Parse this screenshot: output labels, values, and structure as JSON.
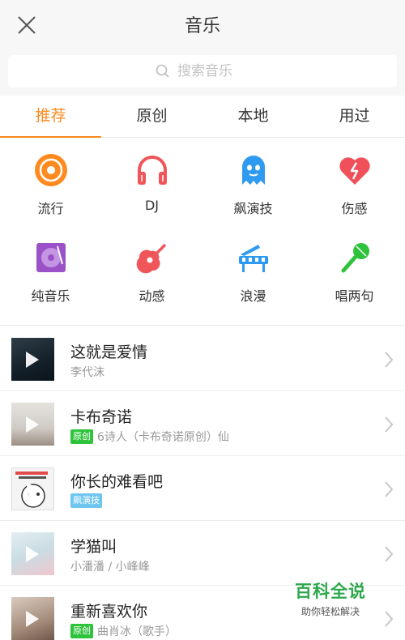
{
  "header": {
    "title": "音乐"
  },
  "search": {
    "placeholder": "搜索音乐"
  },
  "tabs": [
    {
      "label": "推荐",
      "active": true
    },
    {
      "label": "原创",
      "active": false
    },
    {
      "label": "本地",
      "active": false
    },
    {
      "label": "用过",
      "active": false
    }
  ],
  "genres": [
    {
      "label": "流行",
      "icon": "vinyl-record-icon",
      "color": "#ff8a1f"
    },
    {
      "label": "DJ",
      "icon": "headphones-icon",
      "color": "#f0555a"
    },
    {
      "label": "飙演技",
      "icon": "ghost-icon",
      "color": "#2f9bf0"
    },
    {
      "label": "伤感",
      "icon": "broken-heart-icon",
      "color": "#f0505a"
    },
    {
      "label": "纯音乐",
      "icon": "album-disc-icon",
      "color": "#9b52c8"
    },
    {
      "label": "动感",
      "icon": "guitar-icon",
      "color": "#f0555a"
    },
    {
      "label": "浪漫",
      "icon": "piano-icon",
      "color": "#2f9bf0"
    },
    {
      "label": "唱两句",
      "icon": "microphone-icon",
      "color": "#2fc33b"
    }
  ],
  "songs": [
    {
      "title": "这就是爱情",
      "artist": "李代沫",
      "badge": "",
      "cover_color": "#1d2a33"
    },
    {
      "title": "卡布奇诺",
      "artist": "6诗人（卡布奇诺原创）仙",
      "badge": "原创",
      "cover_color": "#d9d6d2"
    },
    {
      "title": "你长的难看吧",
      "artist": "",
      "badge": "飙演技",
      "cover_color": "#f2f2f2"
    },
    {
      "title": "学猫叫",
      "artist": "小潘潘 / 小峰峰",
      "badge": "",
      "cover_color": "#d7e6ea"
    },
    {
      "title": "重新喜欢你",
      "artist": "曲肖冰（歌手）",
      "badge": "原创",
      "cover_color": "#b6a396"
    }
  ],
  "watermark": {
    "main": "百科全说",
    "sub": "助你轻松解决"
  },
  "colors": {
    "accent": "#ff8a1f",
    "original_badge": "#2fc33b",
    "acting_badge": "#6ec6f0"
  }
}
